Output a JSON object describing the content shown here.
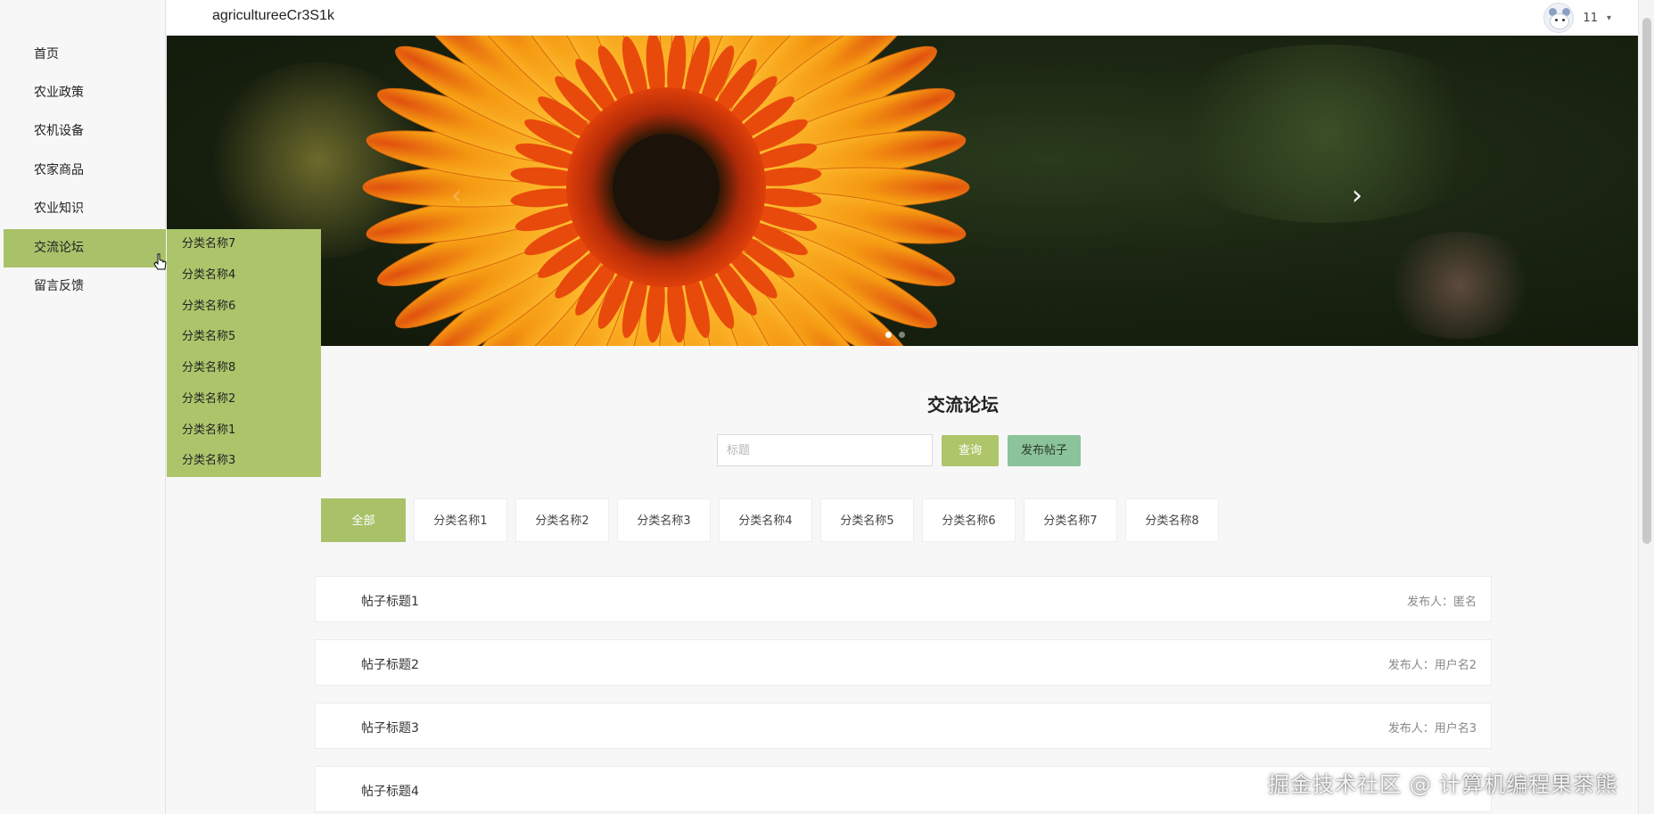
{
  "header": {
    "app_title": "agricultureeCr3S1k",
    "user_name": "11",
    "caret": "▾"
  },
  "sidebar": {
    "items": [
      {
        "label": "首页",
        "active": false
      },
      {
        "label": "农业政策",
        "active": false
      },
      {
        "label": "农机设备",
        "active": false
      },
      {
        "label": "农家商品",
        "active": false
      },
      {
        "label": "农业知识",
        "active": false
      },
      {
        "label": "交流论坛",
        "active": true
      },
      {
        "label": "留言反馈",
        "active": false
      }
    ],
    "submenu": [
      "分类名称7",
      "分类名称4",
      "分类名称6",
      "分类名称5",
      "分类名称8",
      "分类名称2",
      "分类名称1",
      "分类名称3"
    ]
  },
  "banner": {
    "prev_icon": "‹",
    "next_icon": "›",
    "active_slide": 1,
    "slide_count": 2
  },
  "forum": {
    "title": "交流论坛",
    "search_placeholder": "标题",
    "search_value": "",
    "query_label": "查询",
    "publish_label": "发布帖子",
    "categories": [
      "全部",
      "分类名称1",
      "分类名称2",
      "分类名称3",
      "分类名称4",
      "分类名称5",
      "分类名称6",
      "分类名称7",
      "分类名称8"
    ],
    "active_category": "全部",
    "posts": [
      {
        "title": "帖子标题1",
        "author": "发布人：匿名"
      },
      {
        "title": "帖子标题2",
        "author": "发布人：用户名2"
      },
      {
        "title": "帖子标题3",
        "author": "发布人：用户名3"
      },
      {
        "title": "帖子标题4",
        "author": ""
      }
    ]
  },
  "watermark": "掘金技术社区 @ 计算机编程果茶熊",
  "colors": {
    "accent": "#a9c26a",
    "publish_button": "#8bc39a"
  }
}
